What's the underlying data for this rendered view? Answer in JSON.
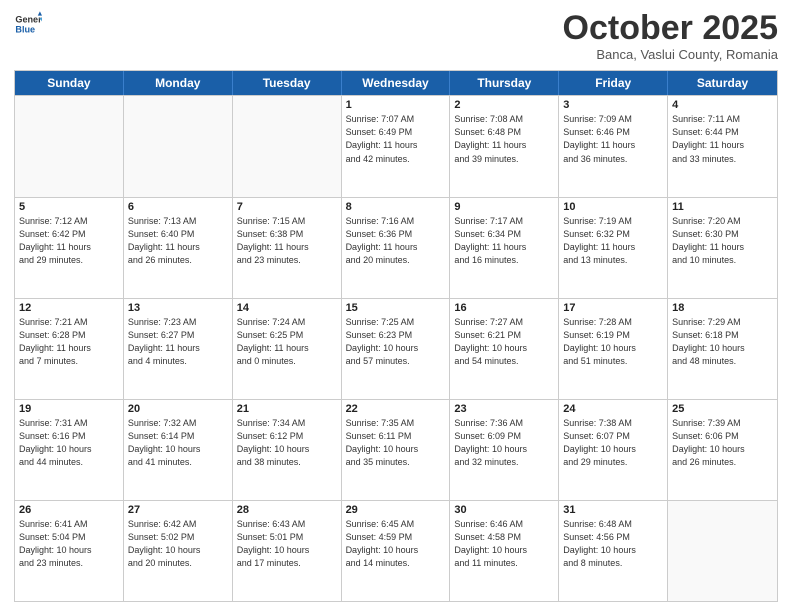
{
  "logo": {
    "general": "General",
    "blue": "Blue"
  },
  "header": {
    "month": "October 2025",
    "location": "Banca, Vaslui County, Romania"
  },
  "days": [
    "Sunday",
    "Monday",
    "Tuesday",
    "Wednesday",
    "Thursday",
    "Friday",
    "Saturday"
  ],
  "weeks": [
    [
      {
        "day": "",
        "info": ""
      },
      {
        "day": "",
        "info": ""
      },
      {
        "day": "",
        "info": ""
      },
      {
        "day": "1",
        "info": "Sunrise: 7:07 AM\nSunset: 6:49 PM\nDaylight: 11 hours\nand 42 minutes."
      },
      {
        "day": "2",
        "info": "Sunrise: 7:08 AM\nSunset: 6:48 PM\nDaylight: 11 hours\nand 39 minutes."
      },
      {
        "day": "3",
        "info": "Sunrise: 7:09 AM\nSunset: 6:46 PM\nDaylight: 11 hours\nand 36 minutes."
      },
      {
        "day": "4",
        "info": "Sunrise: 7:11 AM\nSunset: 6:44 PM\nDaylight: 11 hours\nand 33 minutes."
      }
    ],
    [
      {
        "day": "5",
        "info": "Sunrise: 7:12 AM\nSunset: 6:42 PM\nDaylight: 11 hours\nand 29 minutes."
      },
      {
        "day": "6",
        "info": "Sunrise: 7:13 AM\nSunset: 6:40 PM\nDaylight: 11 hours\nand 26 minutes."
      },
      {
        "day": "7",
        "info": "Sunrise: 7:15 AM\nSunset: 6:38 PM\nDaylight: 11 hours\nand 23 minutes."
      },
      {
        "day": "8",
        "info": "Sunrise: 7:16 AM\nSunset: 6:36 PM\nDaylight: 11 hours\nand 20 minutes."
      },
      {
        "day": "9",
        "info": "Sunrise: 7:17 AM\nSunset: 6:34 PM\nDaylight: 11 hours\nand 16 minutes."
      },
      {
        "day": "10",
        "info": "Sunrise: 7:19 AM\nSunset: 6:32 PM\nDaylight: 11 hours\nand 13 minutes."
      },
      {
        "day": "11",
        "info": "Sunrise: 7:20 AM\nSunset: 6:30 PM\nDaylight: 11 hours\nand 10 minutes."
      }
    ],
    [
      {
        "day": "12",
        "info": "Sunrise: 7:21 AM\nSunset: 6:28 PM\nDaylight: 11 hours\nand 7 minutes."
      },
      {
        "day": "13",
        "info": "Sunrise: 7:23 AM\nSunset: 6:27 PM\nDaylight: 11 hours\nand 4 minutes."
      },
      {
        "day": "14",
        "info": "Sunrise: 7:24 AM\nSunset: 6:25 PM\nDaylight: 11 hours\nand 0 minutes."
      },
      {
        "day": "15",
        "info": "Sunrise: 7:25 AM\nSunset: 6:23 PM\nDaylight: 10 hours\nand 57 minutes."
      },
      {
        "day": "16",
        "info": "Sunrise: 7:27 AM\nSunset: 6:21 PM\nDaylight: 10 hours\nand 54 minutes."
      },
      {
        "day": "17",
        "info": "Sunrise: 7:28 AM\nSunset: 6:19 PM\nDaylight: 10 hours\nand 51 minutes."
      },
      {
        "day": "18",
        "info": "Sunrise: 7:29 AM\nSunset: 6:18 PM\nDaylight: 10 hours\nand 48 minutes."
      }
    ],
    [
      {
        "day": "19",
        "info": "Sunrise: 7:31 AM\nSunset: 6:16 PM\nDaylight: 10 hours\nand 44 minutes."
      },
      {
        "day": "20",
        "info": "Sunrise: 7:32 AM\nSunset: 6:14 PM\nDaylight: 10 hours\nand 41 minutes."
      },
      {
        "day": "21",
        "info": "Sunrise: 7:34 AM\nSunset: 6:12 PM\nDaylight: 10 hours\nand 38 minutes."
      },
      {
        "day": "22",
        "info": "Sunrise: 7:35 AM\nSunset: 6:11 PM\nDaylight: 10 hours\nand 35 minutes."
      },
      {
        "day": "23",
        "info": "Sunrise: 7:36 AM\nSunset: 6:09 PM\nDaylight: 10 hours\nand 32 minutes."
      },
      {
        "day": "24",
        "info": "Sunrise: 7:38 AM\nSunset: 6:07 PM\nDaylight: 10 hours\nand 29 minutes."
      },
      {
        "day": "25",
        "info": "Sunrise: 7:39 AM\nSunset: 6:06 PM\nDaylight: 10 hours\nand 26 minutes."
      }
    ],
    [
      {
        "day": "26",
        "info": "Sunrise: 6:41 AM\nSunset: 5:04 PM\nDaylight: 10 hours\nand 23 minutes."
      },
      {
        "day": "27",
        "info": "Sunrise: 6:42 AM\nSunset: 5:02 PM\nDaylight: 10 hours\nand 20 minutes."
      },
      {
        "day": "28",
        "info": "Sunrise: 6:43 AM\nSunset: 5:01 PM\nDaylight: 10 hours\nand 17 minutes."
      },
      {
        "day": "29",
        "info": "Sunrise: 6:45 AM\nSunset: 4:59 PM\nDaylight: 10 hours\nand 14 minutes."
      },
      {
        "day": "30",
        "info": "Sunrise: 6:46 AM\nSunset: 4:58 PM\nDaylight: 10 hours\nand 11 minutes."
      },
      {
        "day": "31",
        "info": "Sunrise: 6:48 AM\nSunset: 4:56 PM\nDaylight: 10 hours\nand 8 minutes."
      },
      {
        "day": "",
        "info": ""
      }
    ]
  ]
}
